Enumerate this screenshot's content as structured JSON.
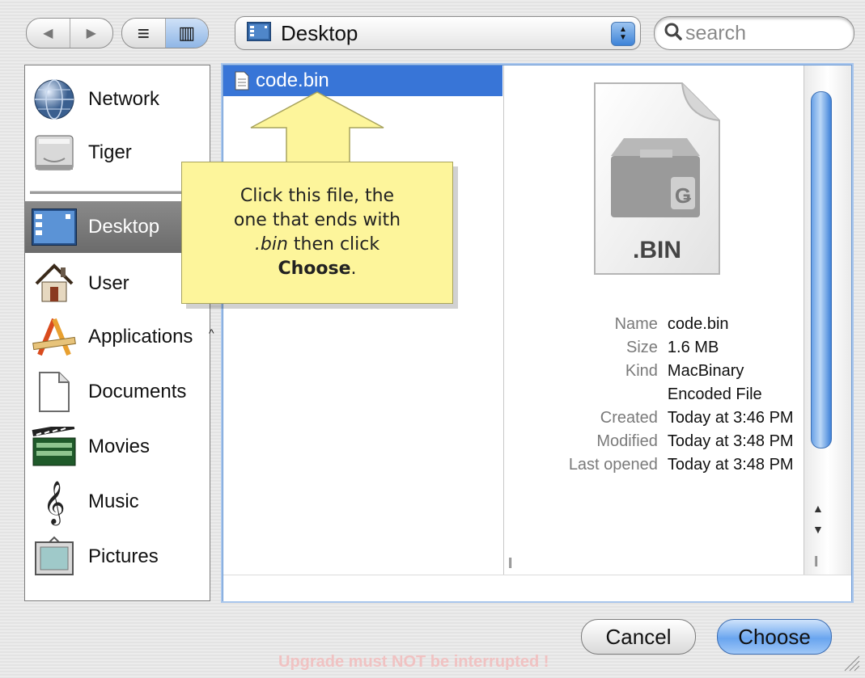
{
  "toolbar": {
    "back_label": "◀",
    "forward_label": "▶",
    "list_view_label": "≡",
    "column_view_label": "▥",
    "location": "Desktop",
    "search_placeholder": "search",
    "search_glyph": "Q"
  },
  "sidebar": {
    "items": [
      {
        "label": "Network",
        "icon": "network-globe-icon"
      },
      {
        "label": "Tiger",
        "icon": "hard-drive-icon"
      },
      {
        "label": "Desktop",
        "icon": "desktop-icon",
        "selected": true
      },
      {
        "label": "User",
        "icon": "home-icon"
      },
      {
        "label": "Applications",
        "icon": "applications-icon"
      },
      {
        "label": "Documents",
        "icon": "documents-icon"
      },
      {
        "label": "Movies",
        "icon": "movies-icon"
      },
      {
        "label": "Music",
        "icon": "music-icon"
      },
      {
        "label": "Pictures",
        "icon": "pictures-icon"
      }
    ]
  },
  "browser": {
    "file": {
      "name": "code.bin",
      "icon": "document-icon"
    },
    "preview": {
      "icon_label": ".BIN",
      "rows": [
        {
          "key": "Name",
          "value": "code.bin"
        },
        {
          "key": "Size",
          "value": "1.6 MB"
        },
        {
          "key": "Kind",
          "value": "MacBinary Encoded File"
        },
        {
          "key": "Created",
          "value": "Today at 3:46 PM"
        },
        {
          "key": "Modified",
          "value": "Today at 3:48 PM"
        },
        {
          "key": "Last opened",
          "value": "Today at 3:48 PM"
        }
      ]
    }
  },
  "callout": {
    "line1": "Click this file, the",
    "line2": "one that ends with",
    "ext": ".bin",
    "line3_rest": " then click",
    "choose": "Choose",
    "period": "."
  },
  "buttons": {
    "cancel": "Cancel",
    "choose": "Choose"
  },
  "status_text": "Upgrade must NOT be interrupted !",
  "colors": {
    "selection": "#3875d7",
    "callout": "#fdf59b",
    "sidebar_selected": "#767676"
  }
}
